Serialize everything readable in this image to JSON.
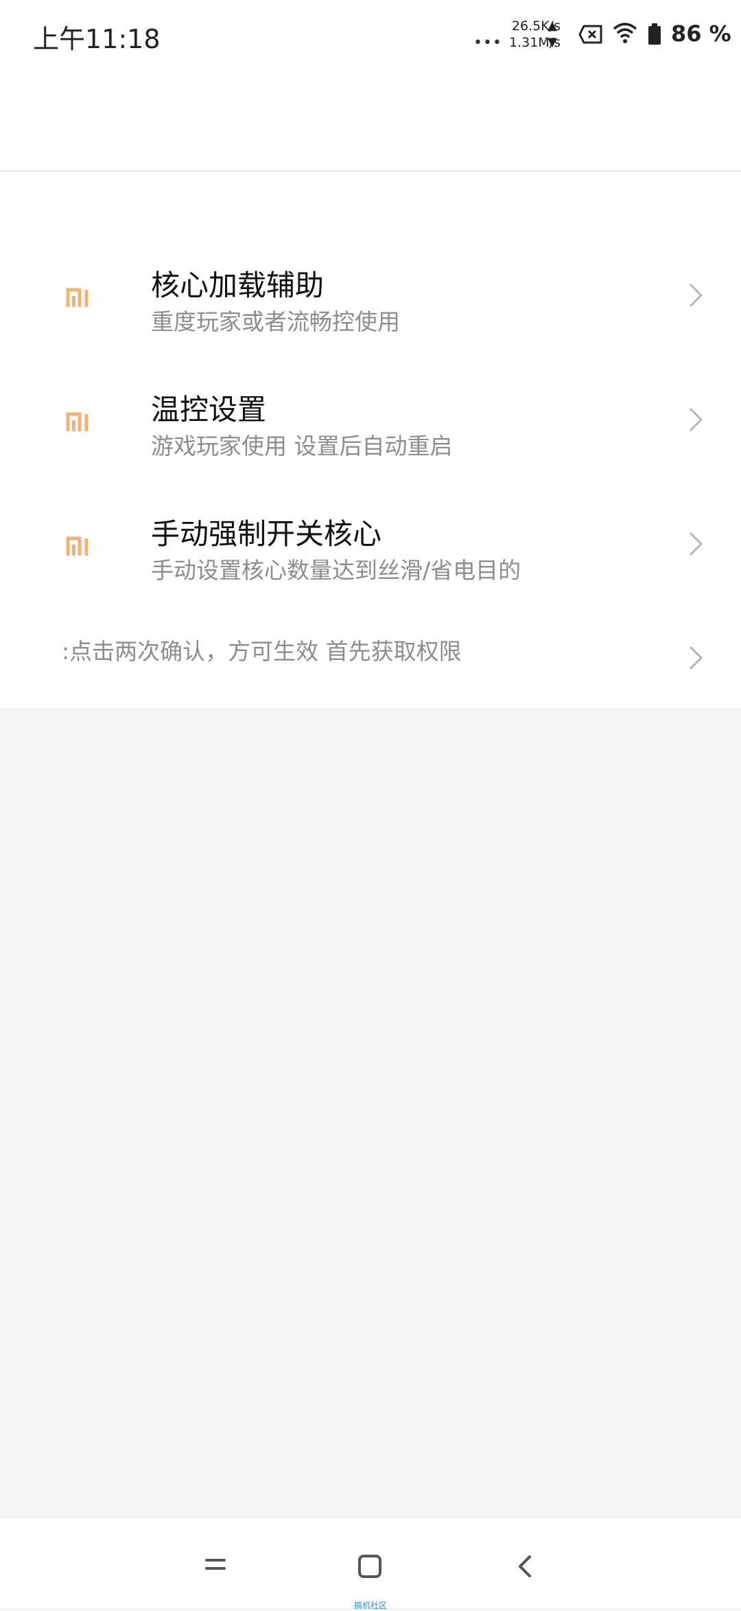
{
  "status_bar": {
    "time": "上午11:18",
    "upload_speed": "26.5K/s",
    "download_speed": "1.31M/s",
    "battery_percent": "86 %"
  },
  "menu": {
    "items": [
      {
        "title": "核心加载辅助",
        "subtitle": "重度玩家或者流畅控使用",
        "icon": "mi-logo-icon"
      },
      {
        "title": "温控设置",
        "subtitle": "游戏玩家使用 设置后自动重启",
        "icon": "mi-logo-icon"
      },
      {
        "title": "手动强制开关核心",
        "subtitle": "手动设置核心数量达到丝滑/省电目的",
        "icon": "mi-logo-icon"
      }
    ],
    "note": ":点击两次确认，方可生效 首先获取权限"
  },
  "nav_bar": {
    "label": "搞机社区"
  },
  "colors": {
    "icon_orange": "#f5a35a",
    "subtitle_gray": "#8d8d8d",
    "chevron_gray": "#b5b5b5"
  }
}
